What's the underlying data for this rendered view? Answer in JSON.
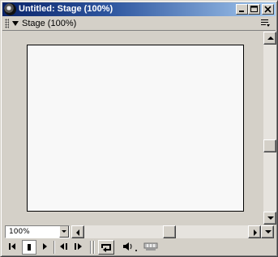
{
  "window": {
    "title": "Untitled: Stage (100%)"
  },
  "panel": {
    "title": "Stage (100%)"
  },
  "zoom": {
    "value": "100%"
  },
  "colors": {
    "titlebar_start": "#0a246a",
    "titlebar_end": "#a6caf0",
    "chrome": "#d4d0c8",
    "stage": "#f8f8f8"
  },
  "icons": {
    "app": "director-logo-icon",
    "minimize": "minimize-icon",
    "maximize": "maximize-icon",
    "close": "close-icon",
    "panel_grip": "grip-icon",
    "panel_collapse": "triangle-down-icon",
    "panel_menu": "panel-options-icon",
    "rewind": "rewind-icon",
    "stop": "stop-icon",
    "play": "play-icon",
    "step_back": "step-back-icon",
    "step_forward": "step-forward-icon",
    "loop": "loop-icon",
    "volume": "speaker-icon",
    "selected_frames": "selected-frames-icon"
  }
}
